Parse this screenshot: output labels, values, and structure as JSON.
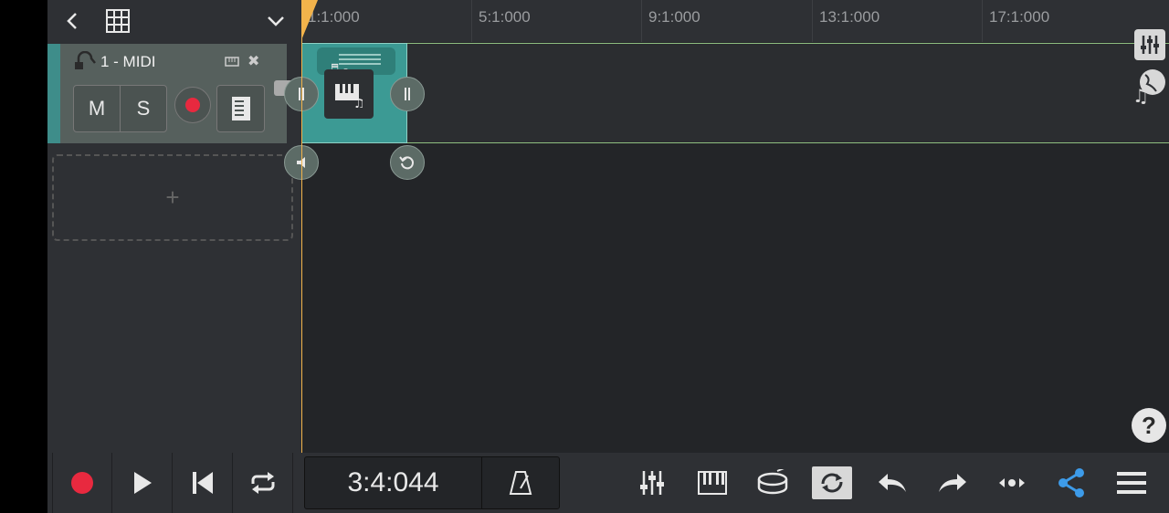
{
  "track_header": {
    "back_icon": "chevron-left-icon",
    "grid_icon": "grid-icon",
    "expand_icon": "chevron-down-icon"
  },
  "track": {
    "name": "1 - MIDI",
    "mute_label": "M",
    "solo_label": "S",
    "strip_color": "#3e8d8a"
  },
  "add_track": {
    "label": "+"
  },
  "ruler": {
    "markers": [
      "1:1:000",
      "5:1:000",
      "9:1:000",
      "13:1:000",
      "17:1:000"
    ]
  },
  "transport": {
    "time": "3:4:044"
  },
  "help": {
    "label": "?"
  },
  "colors": {
    "accent": "#f2b34b",
    "record": "#e8293f",
    "share": "#3d9be9",
    "clip": "#3c9a94"
  }
}
